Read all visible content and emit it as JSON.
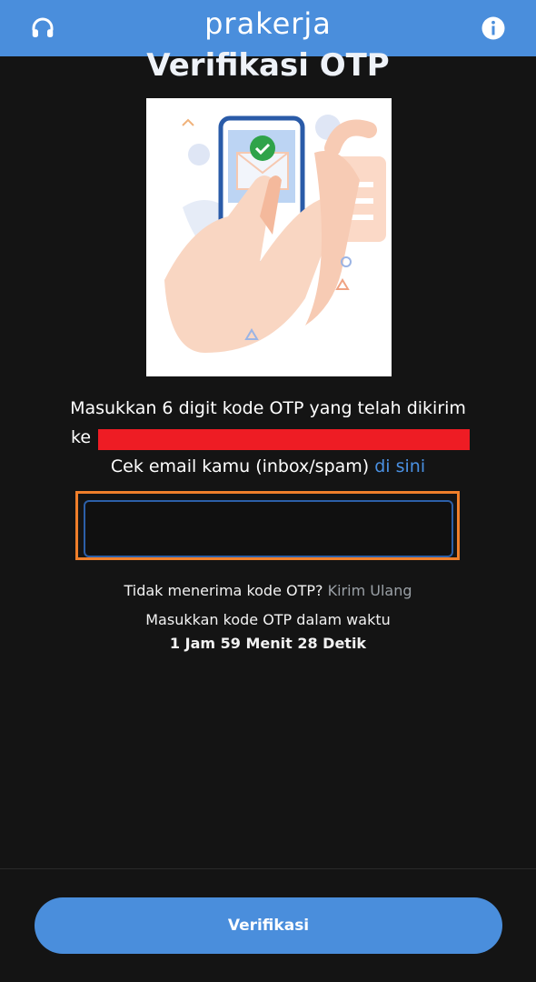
{
  "header": {
    "brand": "prakerja",
    "left_icon": "headset-icon",
    "right_icon": "info-icon",
    "color": "#4a8edc"
  },
  "page_title": "Verifikasi OTP",
  "illustration": {
    "icon": "phone-email-check-illustration"
  },
  "instruction": {
    "line1": "Masukkan 6 digit kode OTP yang telah dikirim",
    "recipient_prefix": "ke",
    "check_email_text": "Cek email kamu (inbox/spam)",
    "check_email_link": "di sini"
  },
  "otp_input": {
    "value": "",
    "placeholder": ""
  },
  "resend": {
    "question": "Tidak menerima kode OTP?",
    "link": "Kirim Ulang"
  },
  "timer": {
    "label": "Masukkan kode OTP dalam waktu",
    "value": "1 Jam 59 Menit 28 Detik"
  },
  "submit_button": {
    "label": "Verifikasi"
  },
  "colors": {
    "accent": "#4a8edc",
    "highlight_frame": "#f07f2a",
    "redaction": "#ee1c24",
    "link": "#4a90e2"
  }
}
